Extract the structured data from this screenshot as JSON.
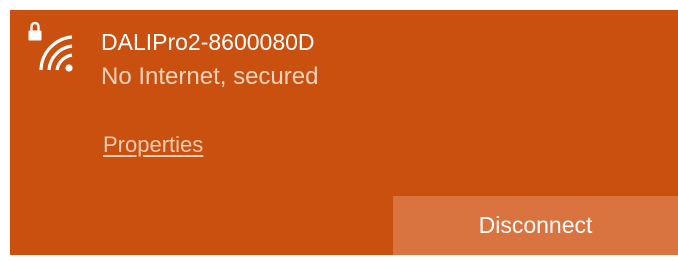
{
  "network": {
    "icon": "wifi-secured-icon",
    "name": "DALIPro2-8600080D",
    "status": "No Internet, secured"
  },
  "links": {
    "properties": "Properties"
  },
  "actions": {
    "disconnect_label": "Disconnect"
  },
  "colors": {
    "panel_background": "#ca5010",
    "button_background": "#d97441",
    "secondary_text": "#f7d4bd"
  }
}
